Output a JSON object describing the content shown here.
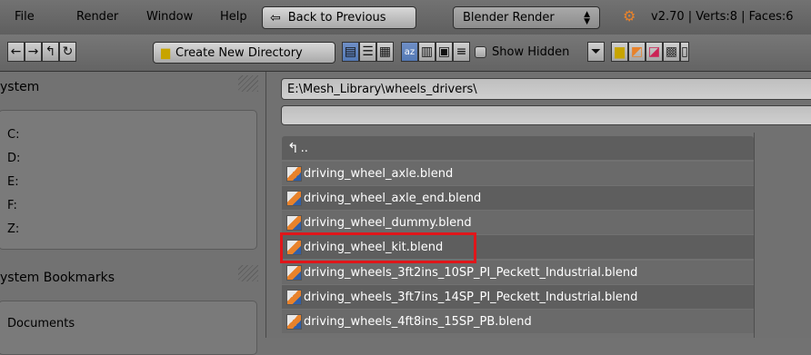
{
  "menubar": {
    "items": [
      "File",
      "Render",
      "Window",
      "Help"
    ],
    "back_label": "Back to Previous",
    "engine_label": "Blender Render",
    "stats": "v2.70 | Verts:8 | Faces:6"
  },
  "toolbar": {
    "create_dir_label": "Create New Directory",
    "show_hidden_label": "Show Hidden"
  },
  "sidebar": {
    "system_title": "ystem",
    "drives": [
      "C:",
      "D:",
      "E:",
      "F:",
      "Z:"
    ],
    "bookmarks_title": "ystem Bookmarks",
    "bookmark_items": [
      "Documents"
    ]
  },
  "browser": {
    "path": "E:\\Mesh_Library\\wheels_drivers\\",
    "filename": "",
    "parent_label": "..",
    "files": [
      "driving_wheel_axle.blend",
      "driving_wheel_axle_end.blend",
      "driving_wheel_dummy.blend",
      "driving_wheel_kit.blend",
      "driving_wheels_3ft2ins_10SP_PI_Peckett_Industrial.blend",
      "driving_wheels_3ft7ins_14SP_PI_Peckett_Industrial.blend",
      "driving_wheels_4ft8ins_15SP_PB.blend"
    ],
    "highlight_color": "#e0161a"
  }
}
